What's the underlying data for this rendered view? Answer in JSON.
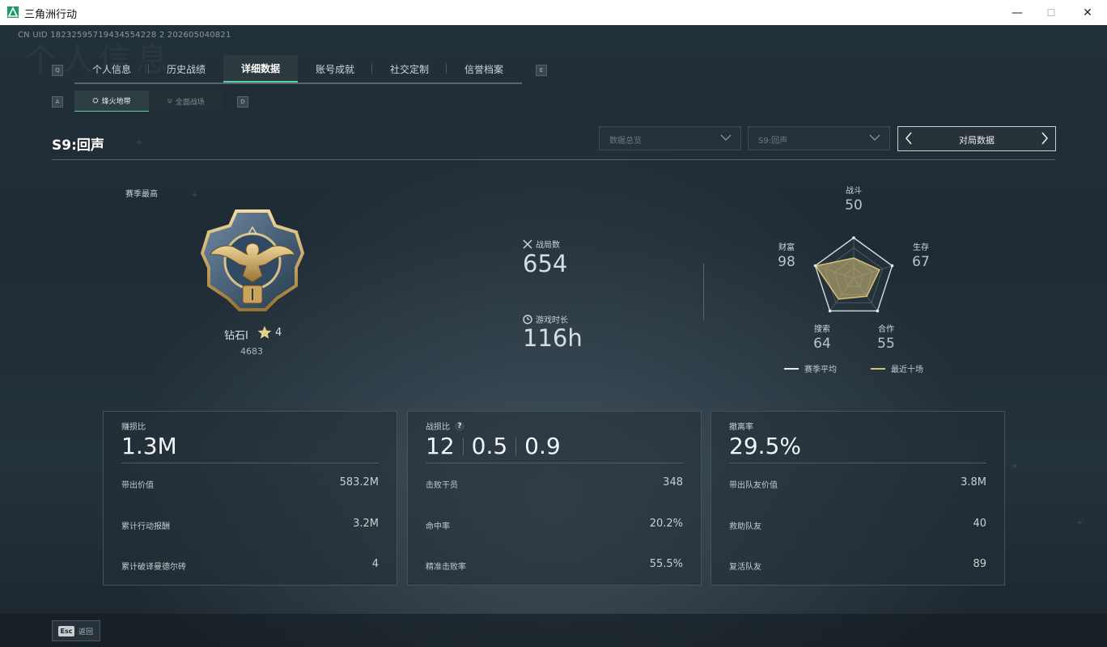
{
  "window": {
    "title": "三角洲行动",
    "minimize": "—",
    "maximize": "☐",
    "close": "✕"
  },
  "uid": "CN UID 18232595719434554228 2 202605040821",
  "tabs": {
    "left_key": "Q",
    "right_key": "E",
    "items": [
      {
        "label": "个人信息",
        "active": false
      },
      {
        "label": "历史战绩",
        "active": false
      },
      {
        "label": "详细数据",
        "active": true
      },
      {
        "label": "账号成就",
        "active": false
      },
      {
        "label": "社交定制",
        "active": false
      },
      {
        "label": "信誉档案",
        "active": false
      }
    ]
  },
  "subtabs": {
    "left_key": "A",
    "right_key": "D",
    "items": [
      {
        "label": "烽火地带",
        "active": true
      },
      {
        "label": "全面战场",
        "active": false
      }
    ]
  },
  "season_title": "S9:回声",
  "filters": {
    "dropdown1": "数据总览",
    "dropdown2": "S9:回声",
    "pager_label": "对局数据"
  },
  "rank": {
    "best_label": "赛季最高",
    "name": "钻石I",
    "stars": "4",
    "points": "4683"
  },
  "stats": {
    "matches_label": "战局数",
    "matches_value": "654",
    "playtime_label": "游戏时长",
    "playtime_value": "116h"
  },
  "radar": {
    "axes": [
      {
        "label": "战斗",
        "value": 50
      },
      {
        "label": "生存",
        "value": 67
      },
      {
        "label": "合作",
        "value": 55
      },
      {
        "label": "搜索",
        "value": 64
      },
      {
        "label": "财富",
        "value": 98
      }
    ],
    "legend": [
      {
        "label": "赛季平均",
        "color": "#e6ecef"
      },
      {
        "label": "最近十场",
        "color": "#d9c17a"
      }
    ]
  },
  "cards": {
    "profit": {
      "label": "赚损比",
      "value": "1.3M",
      "rows": [
        {
          "label": "带出价值",
          "value": "583.2M"
        },
        {
          "label": "累计行动报酬",
          "value": "3.2M"
        },
        {
          "label": "累计破译曼德尔砖",
          "value": "4"
        }
      ]
    },
    "kd": {
      "label": "战损比",
      "help": "?",
      "values": [
        "12",
        "0.5",
        "0.9"
      ],
      "rows": [
        {
          "label": "击败干员",
          "value": "348"
        },
        {
          "label": "命中率",
          "value": "20.2%"
        },
        {
          "label": "精准击败率",
          "value": "55.5%"
        }
      ]
    },
    "extract": {
      "label": "撤离率",
      "value": "29.5%",
      "rows": [
        {
          "label": "带出队友价值",
          "value": "3.8M"
        },
        {
          "label": "救助队友",
          "value": "40"
        },
        {
          "label": "复活队友",
          "value": "89"
        }
      ]
    }
  },
  "footer": {
    "esc_key": "Esc",
    "esc_label": "返回"
  },
  "colors": {
    "accent": "#4fd3a3",
    "gold": "#d9c17a"
  }
}
